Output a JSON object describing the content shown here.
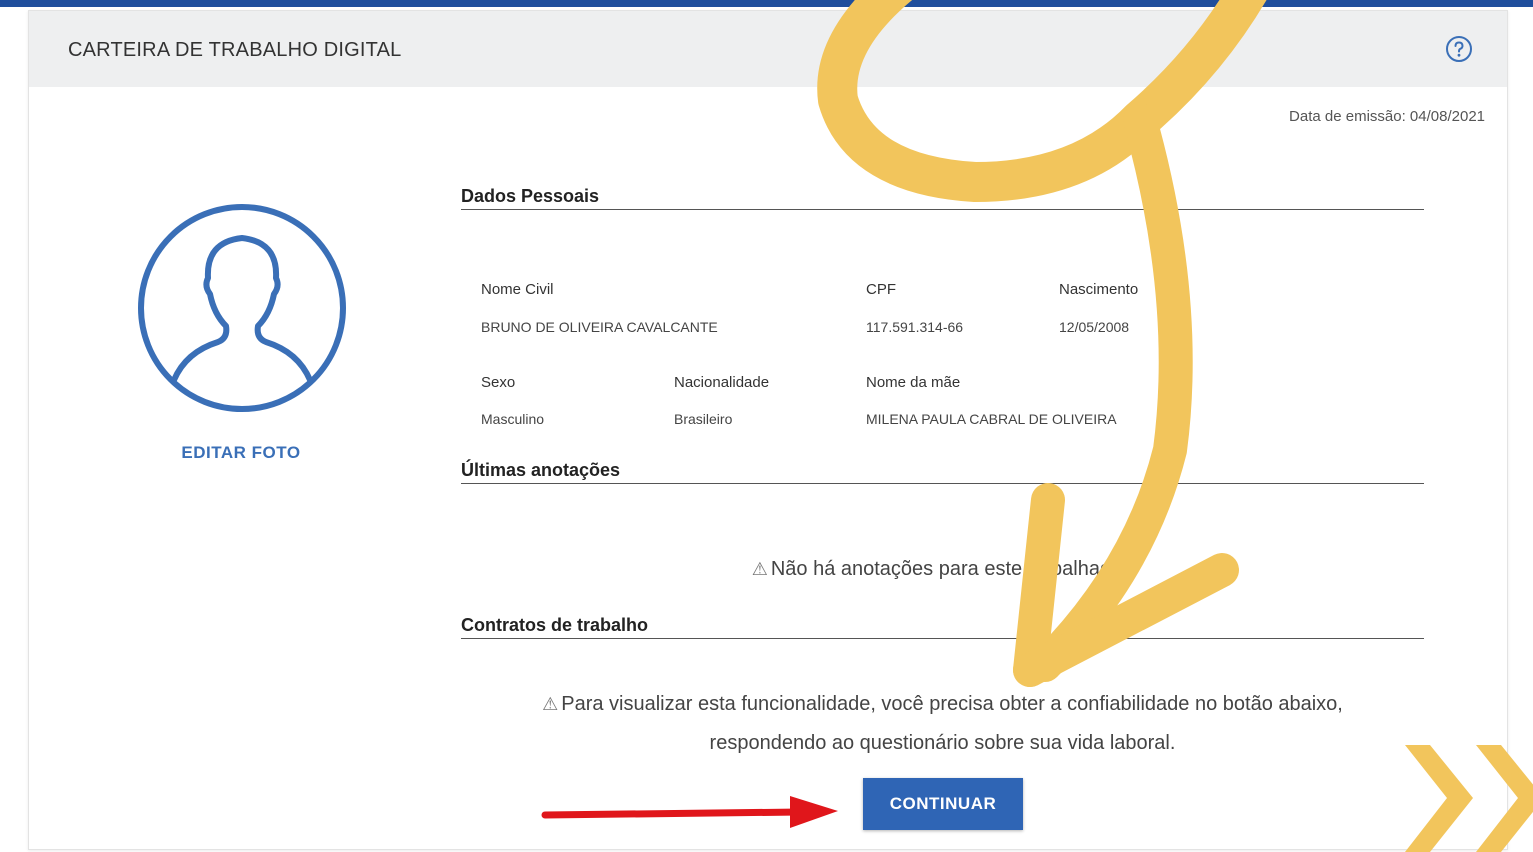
{
  "header": {
    "title": "CARTEIRA DE TRABALHO DIGITAL",
    "help_icon": "question-circle-icon"
  },
  "emission": "Data de emissão: 04/08/2021",
  "profile": {
    "avatar_icon": "user-silhouette-icon",
    "edit_photo_label": "EDITAR FOTO"
  },
  "personal": {
    "section_title": "Dados Pessoais",
    "fields": {
      "nome_civil": {
        "label": "Nome Civil",
        "value": "BRUNO DE OLIVEIRA CAVALCANTE"
      },
      "cpf": {
        "label": "CPF",
        "value": "117.591.314-66"
      },
      "nascimento": {
        "label": "Nascimento",
        "value": "12/05/2008"
      },
      "sexo": {
        "label": "Sexo",
        "value": "Masculino"
      },
      "nacionalidade": {
        "label": "Nacionalidade",
        "value": "Brasileiro"
      },
      "nome_mae": {
        "label": "Nome da mãe",
        "value": "MILENA PAULA CABRAL DE OLIVEIRA"
      }
    }
  },
  "annotations": {
    "section_title": "Últimas anotações",
    "empty_message": "Não há anotações para este trabalhador."
  },
  "contracts": {
    "section_title": "Contratos de trabalho",
    "message_line1": "Para visualizar esta funcionalidade, você precisa obter a confiabilidade no botão abaixo,",
    "message_line2": "respondendo ao questionário sobre sua vida laboral.",
    "continue_label": "CONTINUAR"
  },
  "colors": {
    "brand_blue": "#2f65b5",
    "top_bar": "#1f4e9c",
    "overlay_yellow": "#f2c55c",
    "arrow_red": "#e0161b"
  }
}
